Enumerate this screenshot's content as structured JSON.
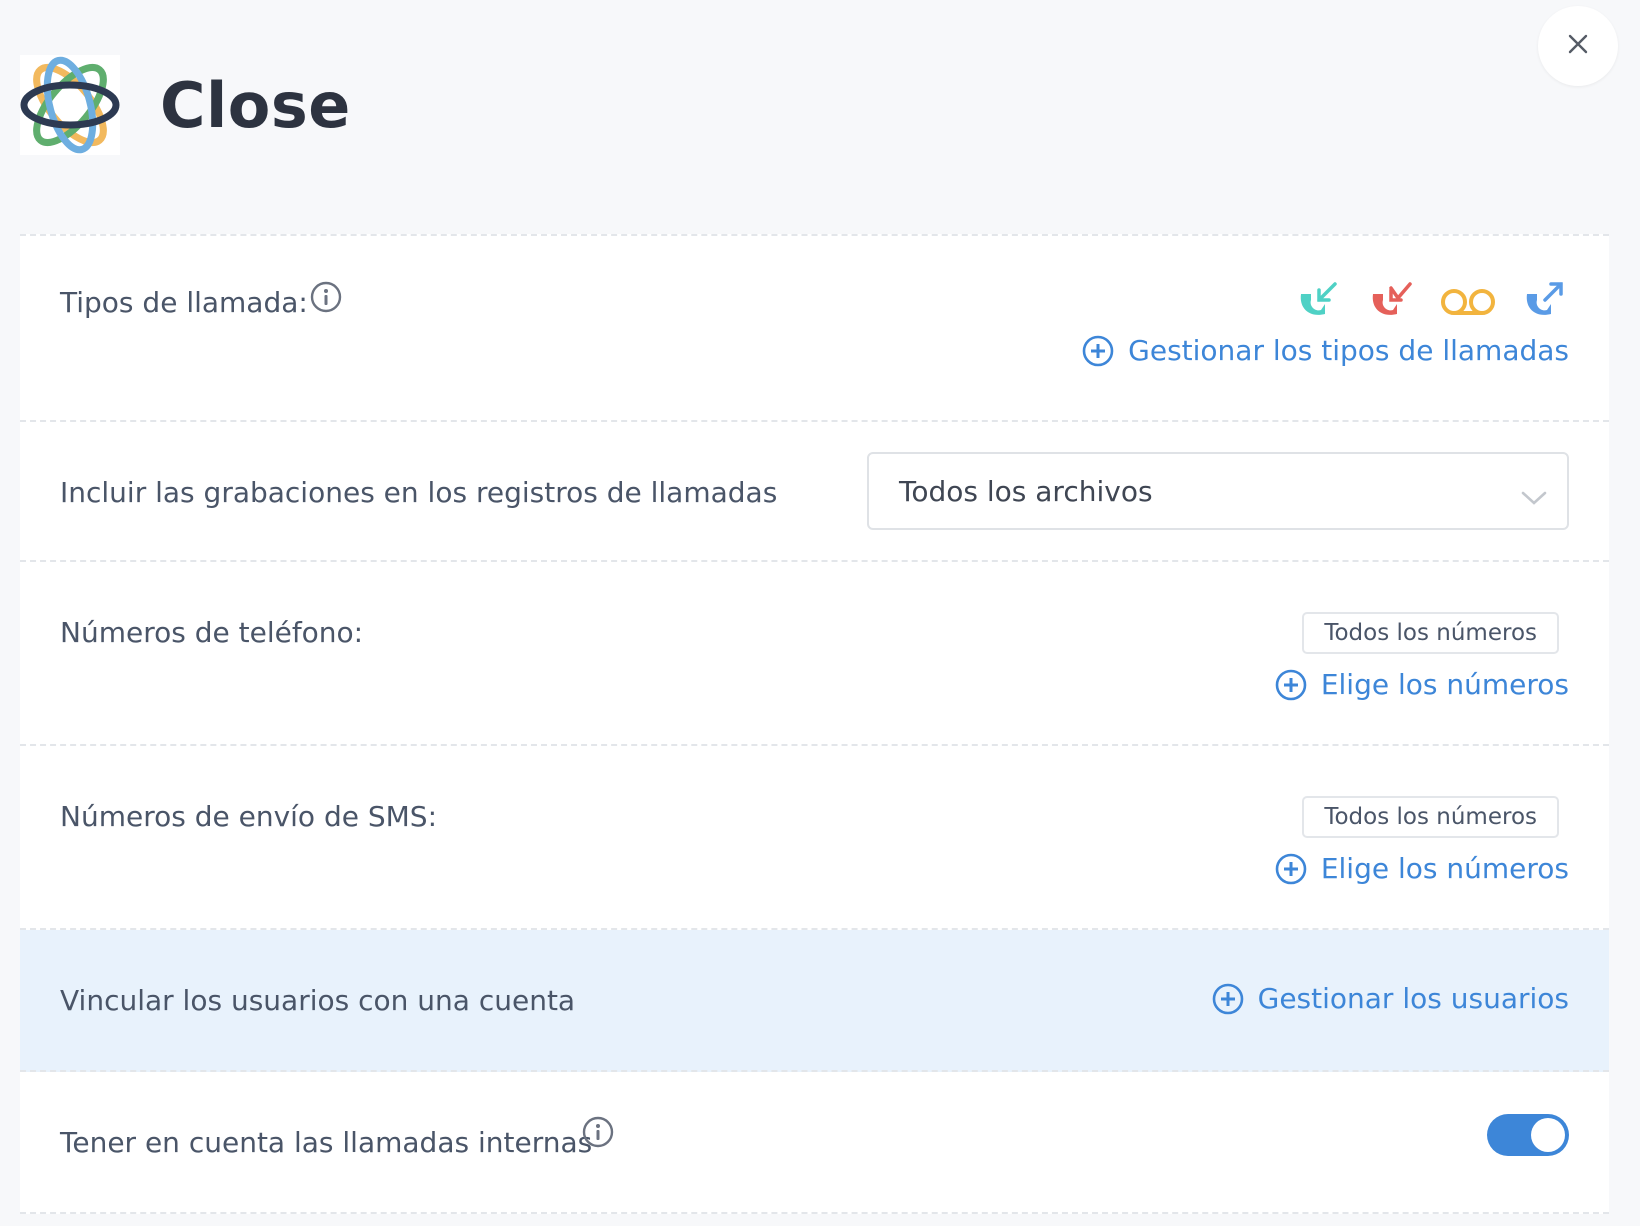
{
  "app": {
    "title": "Close",
    "logo_icon": "close-crm-logo-icon",
    "close_icon": "close-icon"
  },
  "settings": {
    "call_types": {
      "label": "Tipos de llamada:",
      "info_icon": "info-icon",
      "icons": [
        "incoming-call-icon",
        "missed-call-icon",
        "voicemail-icon",
        "outgoing-call-icon"
      ],
      "icon_colors": [
        "#4fd1c5",
        "#e5605a",
        "#f2b43e",
        "#5a9be6"
      ],
      "manage_link": "Gestionar los tipos de llamadas"
    },
    "recordings": {
      "label": "Incluir las grabaciones en los registros de llamadas",
      "selected": "Todos los archivos"
    },
    "phone_numbers": {
      "label": "Números de teléfono:",
      "chip": "Todos los números",
      "link": "Elige los números"
    },
    "sms_numbers": {
      "label": "Números de envío de SMS:",
      "chip": "Todos los números",
      "link": "Elige los números"
    },
    "users": {
      "label": "Vincular los usuarios con una cuenta",
      "link": "Gestionar los usuarios",
      "highlight_color": "#e8f2fc"
    },
    "internal_calls": {
      "label": "Tener en cuenta las llamadas internas",
      "info_icon": "info-icon",
      "enabled": true
    }
  },
  "colors": {
    "accent": "#3d86d8",
    "text": "#4a5568",
    "title": "#2d3340",
    "background": "#f7f8fa"
  }
}
